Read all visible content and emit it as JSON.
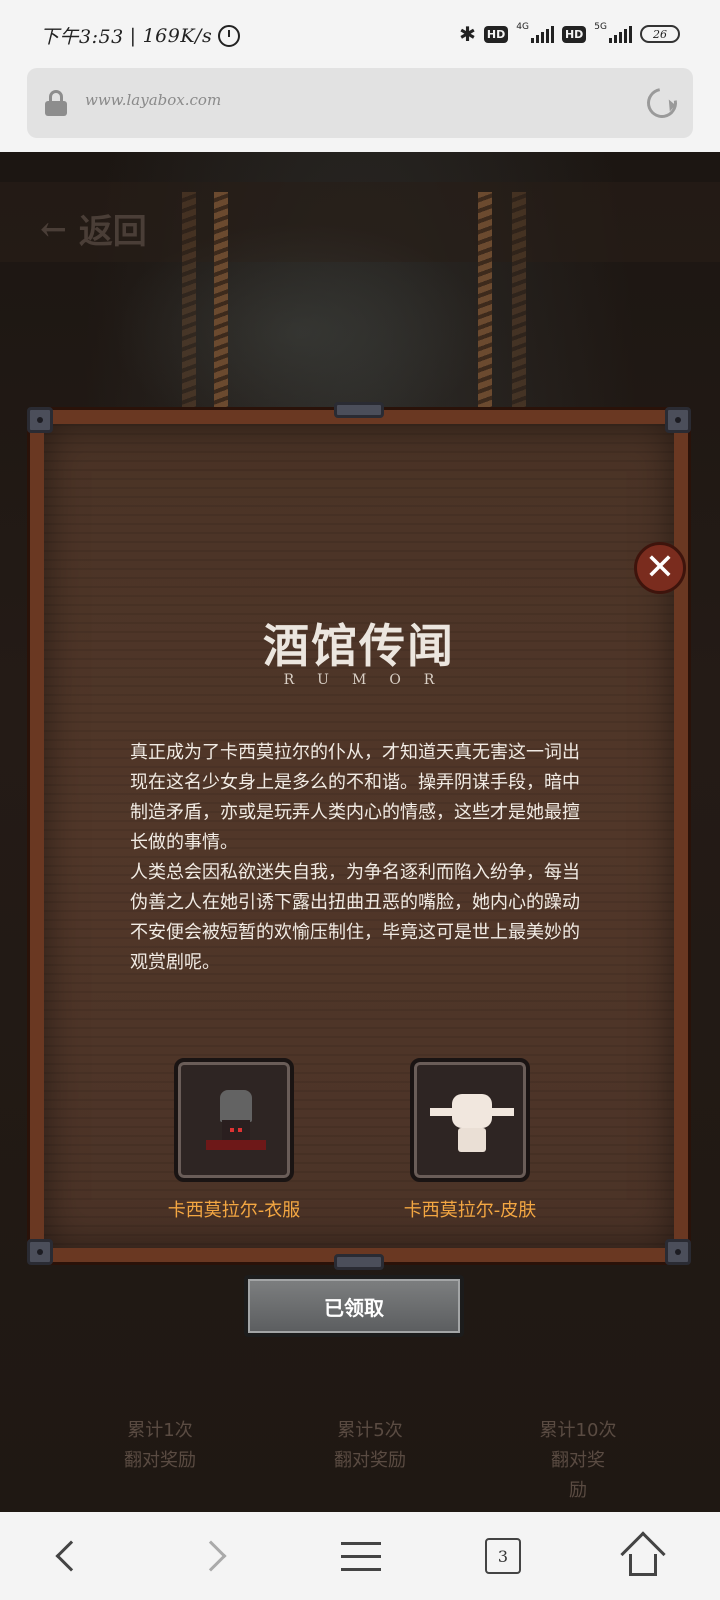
{
  "status_bar": {
    "time": "下午3:53",
    "net_speed": "169K/s",
    "hd1": "HD",
    "net1": "4G",
    "hd2": "HD",
    "net2": "5G",
    "battery": "26"
  },
  "browser": {
    "url": "www.layabox.com"
  },
  "game": {
    "back_label": "返回",
    "popup": {
      "title": "酒馆传闻",
      "subtitle": "RUMOR",
      "story_p1": "真正成为了卡西莫拉尔的仆从，才知道天真无害这一词出现在这名少女身上是多么的不和谐。操弄阴谋手段，暗中制造矛盾，亦或是玩弄人类内心的情感，这些才是她最擅长做的事情。",
      "story_p2": "人类总会因私欲迷失自我，为争名逐利而陷入纷争，每当伪善之人在她引诱下露出扭曲丑恶的嘴脸，她内心的躁动不安便会被短暂的欢愉压制住，毕竟这可是世上最美妙的观赏剧呢。",
      "rewards": [
        {
          "name": "卡西莫拉尔-衣服",
          "icon": "outfit-icon"
        },
        {
          "name": "卡西莫拉尔-皮肤",
          "icon": "skin-icon"
        }
      ],
      "claimed_label": "已领取",
      "close_symbol": "✕"
    },
    "tallies": [
      {
        "line1": "累计1次",
        "line2": "翻对奖励",
        "line3": ""
      },
      {
        "line1": "累计5次",
        "line2": "翻对奖励",
        "line3": ""
      },
      {
        "line1": "累计10次",
        "line2": "翻对奖",
        "line3": "励"
      }
    ]
  },
  "bottom_nav": {
    "tab_count": "3"
  }
}
